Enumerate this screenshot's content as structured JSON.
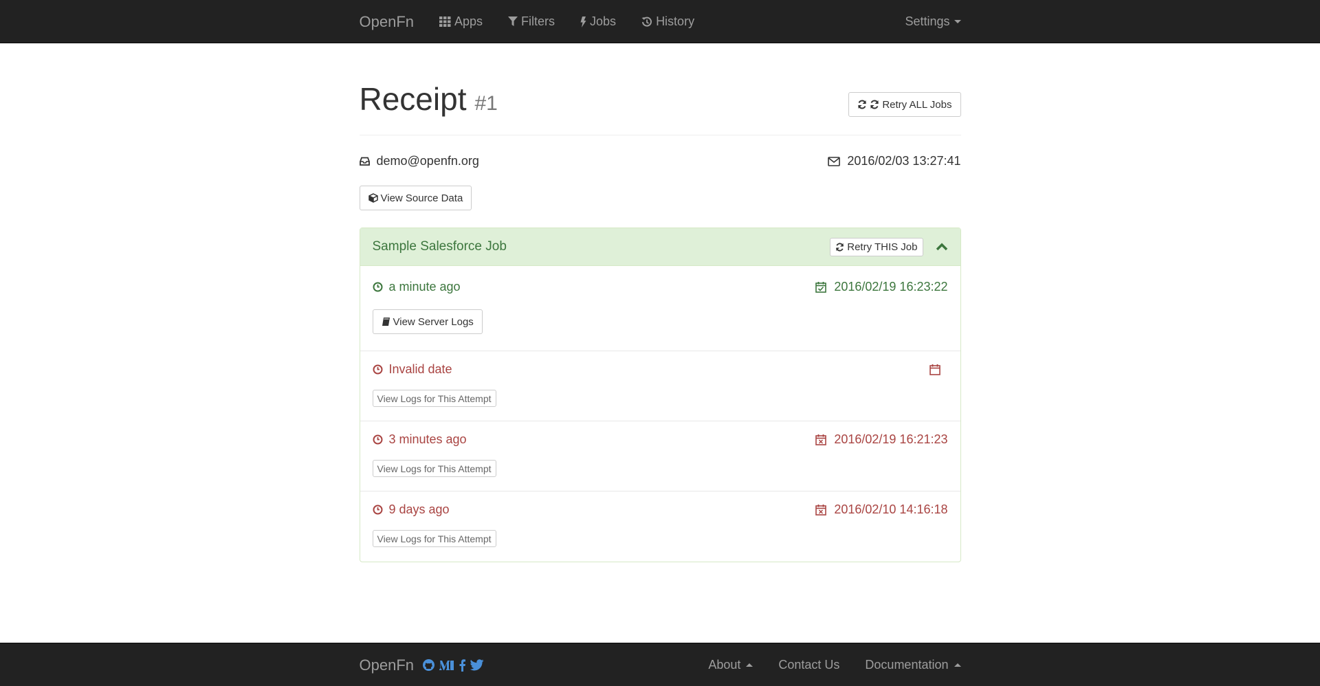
{
  "nav": {
    "brand": "OpenFn",
    "items": [
      {
        "label": "Apps",
        "icon": "grid-icon"
      },
      {
        "label": "Filters",
        "icon": "filter-icon"
      },
      {
        "label": "Jobs",
        "icon": "bolt-icon"
      },
      {
        "label": "History",
        "icon": "history-icon"
      }
    ],
    "settings": "Settings"
  },
  "header": {
    "title": "Receipt",
    "number": "#1",
    "retry_all": "Retry ALL Jobs"
  },
  "meta": {
    "email": "demo@openfn.org",
    "received": "2016/02/03 13:27:41"
  },
  "view_source": "View Source Data",
  "job": {
    "title": "Sample Salesforce Job",
    "retry_this": "Retry THIS Job",
    "attempts": [
      {
        "status": "success",
        "relative": "a minute ago",
        "date": "2016/02/19 16:23:22",
        "button": "View Server Logs"
      },
      {
        "status": "fail",
        "relative": "Invalid date",
        "date": "",
        "button": "View Logs for This Attempt"
      },
      {
        "status": "fail",
        "relative": "3 minutes ago",
        "date": "2016/02/19 16:21:23",
        "button": "View Logs for This Attempt"
      },
      {
        "status": "fail",
        "relative": "9 days ago",
        "date": "2016/02/10 14:16:18",
        "button": "View Logs for This Attempt"
      }
    ]
  },
  "colors": {
    "navbar": "#222222",
    "success": "#3c763d",
    "danger": "#a94442",
    "panel_heading": "#dff0d8",
    "social": "#4a90d9"
  },
  "footer": {
    "brand": "OpenFn",
    "social_icons": [
      "github-icon",
      "medium-icon",
      "facebook-icon",
      "twitter-icon"
    ],
    "about": "About",
    "contact": "Contact Us",
    "documentation": "Documentation"
  }
}
